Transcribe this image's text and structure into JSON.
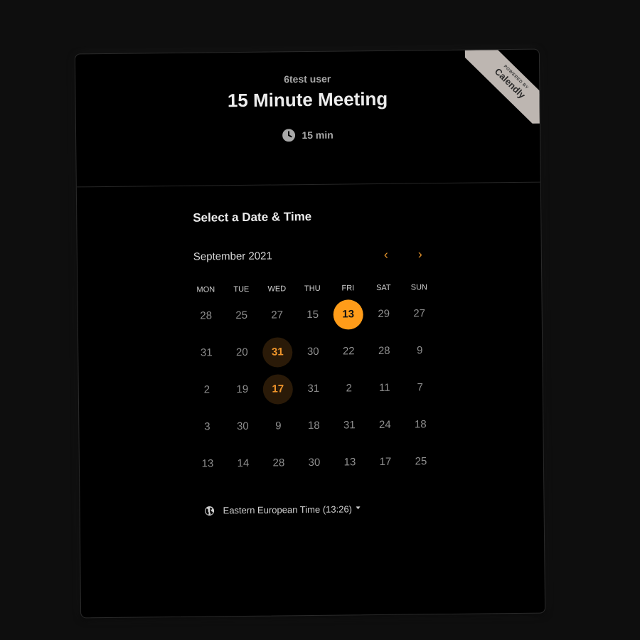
{
  "ribbon": {
    "powered_by": "POWERED BY",
    "brand": "Calendly"
  },
  "header": {
    "host": "6test user",
    "title": "15 Minute Meeting",
    "duration": "15 min"
  },
  "picker": {
    "section_title": "Select a Date & Time",
    "month": "September 2021",
    "prev_icon": "chevron-left-icon",
    "next_icon": "chevron-right-icon",
    "weekdays": [
      "MON",
      "TUE",
      "WED",
      "THU",
      "FRI",
      "SAT",
      "SUN"
    ],
    "weeks": [
      [
        {
          "label": "28",
          "state": "disabled"
        },
        {
          "label": "25",
          "state": "disabled"
        },
        {
          "label": "27",
          "state": "disabled"
        },
        {
          "label": "15",
          "state": "disabled"
        },
        {
          "label": "13",
          "state": "selected"
        },
        {
          "label": "29",
          "state": "disabled"
        },
        {
          "label": "27",
          "state": "disabled"
        }
      ],
      [
        {
          "label": "31",
          "state": "disabled"
        },
        {
          "label": "20",
          "state": "disabled"
        },
        {
          "label": "31",
          "state": "available"
        },
        {
          "label": "30",
          "state": "disabled"
        },
        {
          "label": "22",
          "state": "disabled"
        },
        {
          "label": "28",
          "state": "disabled"
        },
        {
          "label": "9",
          "state": "disabled"
        }
      ],
      [
        {
          "label": "2",
          "state": "disabled"
        },
        {
          "label": "19",
          "state": "disabled"
        },
        {
          "label": "17",
          "state": "available"
        },
        {
          "label": "31",
          "state": "disabled"
        },
        {
          "label": "2",
          "state": "disabled"
        },
        {
          "label": "11",
          "state": "disabled"
        },
        {
          "label": "7",
          "state": "disabled"
        }
      ],
      [
        {
          "label": "3",
          "state": "disabled"
        },
        {
          "label": "30",
          "state": "disabled"
        },
        {
          "label": "9",
          "state": "disabled"
        },
        {
          "label": "18",
          "state": "disabled"
        },
        {
          "label": "31",
          "state": "disabled"
        },
        {
          "label": "24",
          "state": "disabled"
        },
        {
          "label": "18",
          "state": "disabled"
        }
      ],
      [
        {
          "label": "13",
          "state": "disabled"
        },
        {
          "label": "14",
          "state": "disabled"
        },
        {
          "label": "28",
          "state": "disabled"
        },
        {
          "label": "30",
          "state": "disabled"
        },
        {
          "label": "13",
          "state": "disabled"
        },
        {
          "label": "17",
          "state": "disabled"
        },
        {
          "label": "25",
          "state": "disabled"
        }
      ]
    ]
  },
  "timezone": {
    "label": "Eastern European Time (13:26)",
    "icon": "globe-icon"
  },
  "colors": {
    "accent": "#ff9c19",
    "available_bg": "#2a1a08",
    "background": "#000000"
  }
}
